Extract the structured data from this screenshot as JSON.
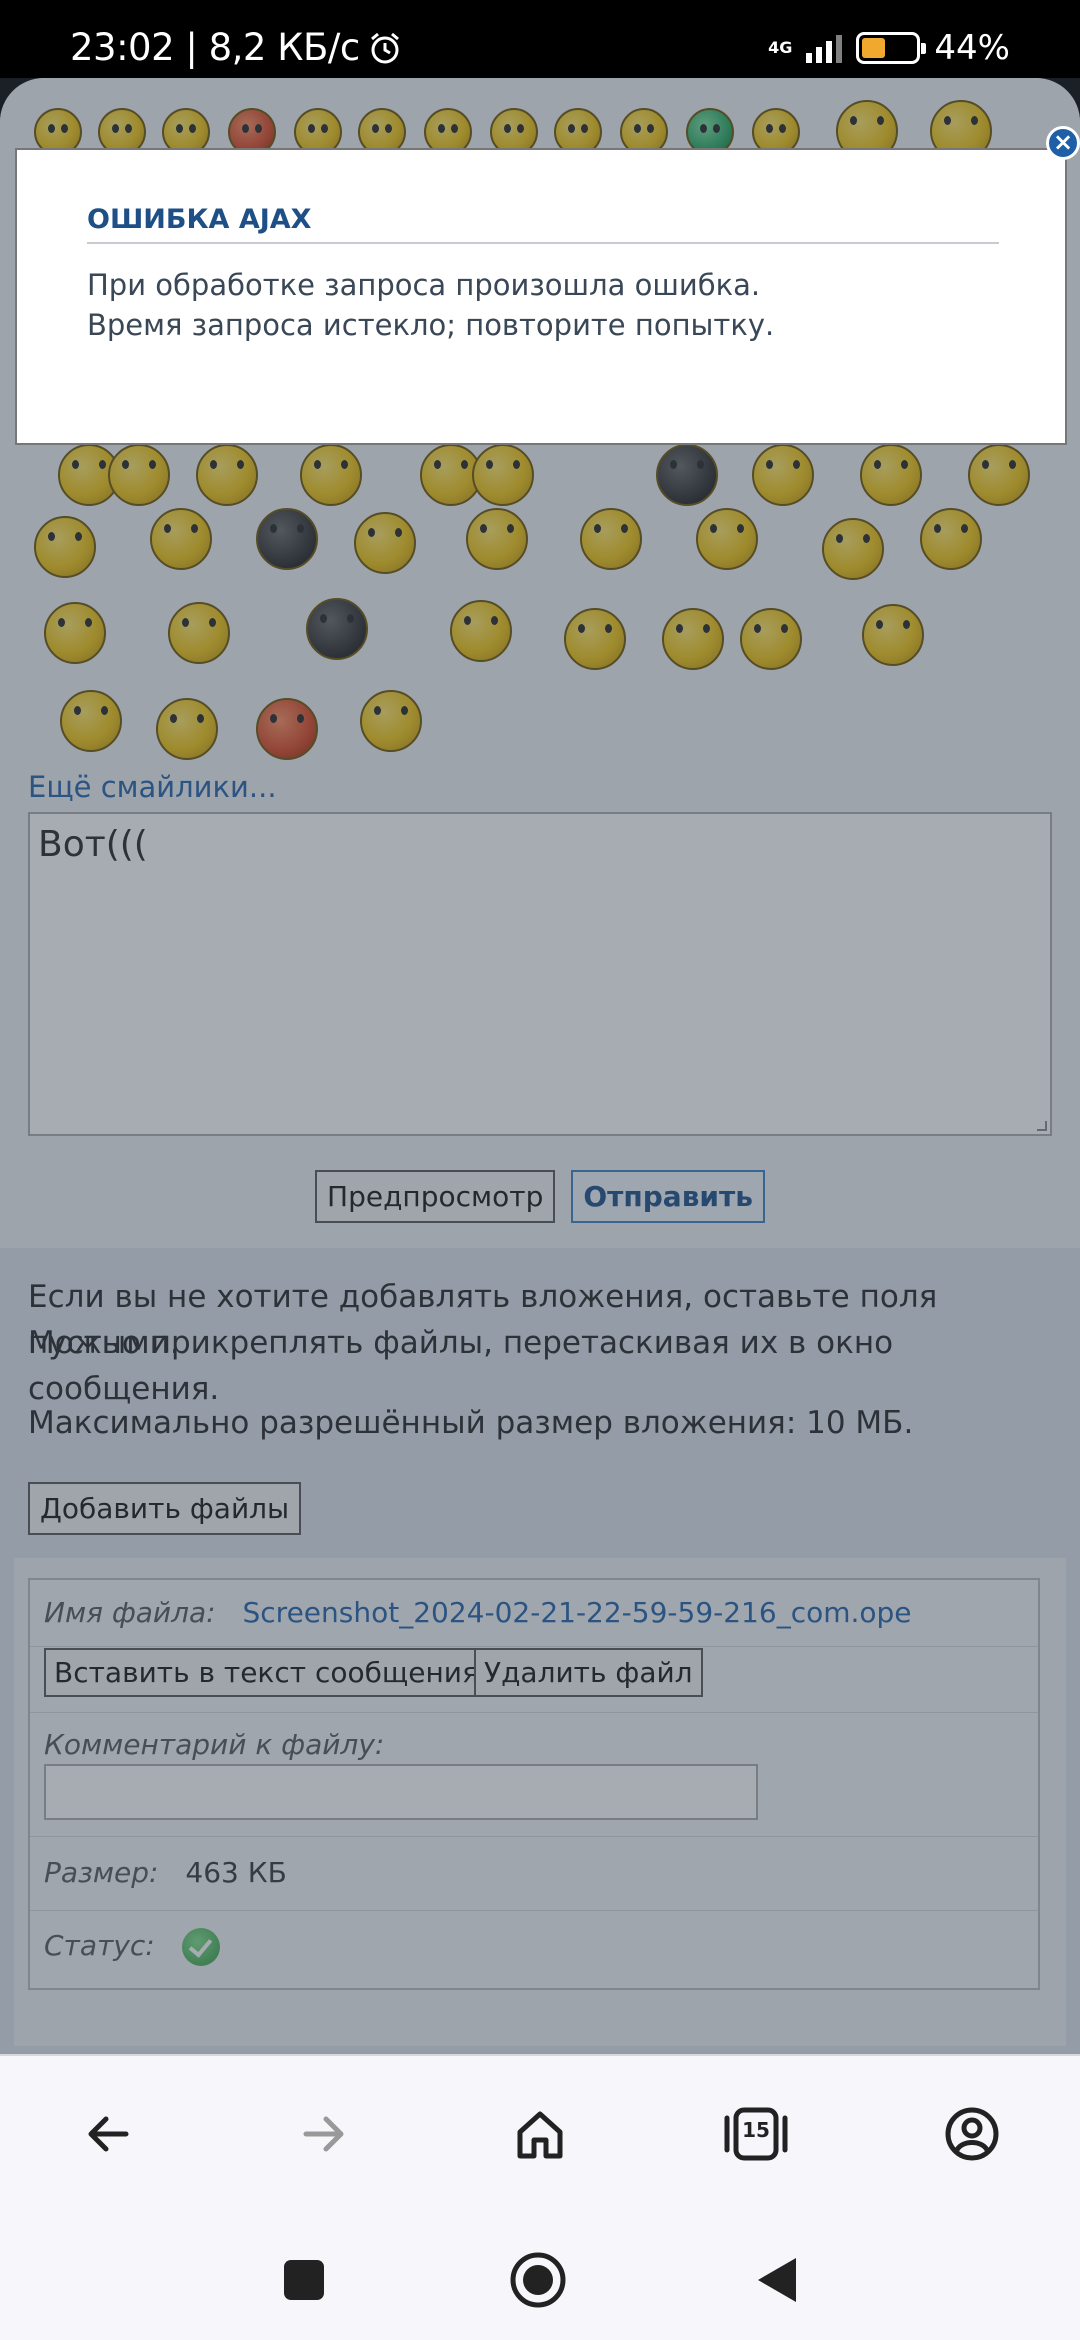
{
  "status_bar": {
    "time_speed": "23:02 | 8,2 КБ/с",
    "network": "4G",
    "battery": "44%",
    "battery_level": 0.44
  },
  "editor": {
    "more_smileys": "Ещё смайлики...",
    "message_text": "Вот(((",
    "preview_label": "Предпросмотр",
    "send_label": "Отправить"
  },
  "attachments": {
    "hint_line1": "Если вы не хотите добавлять вложения, оставьте поля пустыми.",
    "hint_line2": "Можно прикреплять файлы, перетаскивая их в окно сообщения.",
    "max_size": "Максимально разрешённый размер вложения: 10 МБ.",
    "add_files_label": "Добавить файлы",
    "file": {
      "name_label": "Имя файла:",
      "name_value": "Screenshot_2024-02-21-22-59-59-216_com.ope",
      "insert_label": "Вставить в текст сообщения",
      "delete_label": "Удалить файл",
      "comment_label": "Комментарий к файлу:",
      "size_label": "Размер:",
      "size_value": "463 КБ",
      "status_label": "Статус:"
    }
  },
  "modal": {
    "title": "ОШИБКА AJAX",
    "line1": "При обработке запроса произошла ошибка.",
    "line2": "Время запроса истекло; повторите попытку.",
    "close_symbol": "×"
  },
  "browser_bar": {
    "tabs_count": "15"
  }
}
